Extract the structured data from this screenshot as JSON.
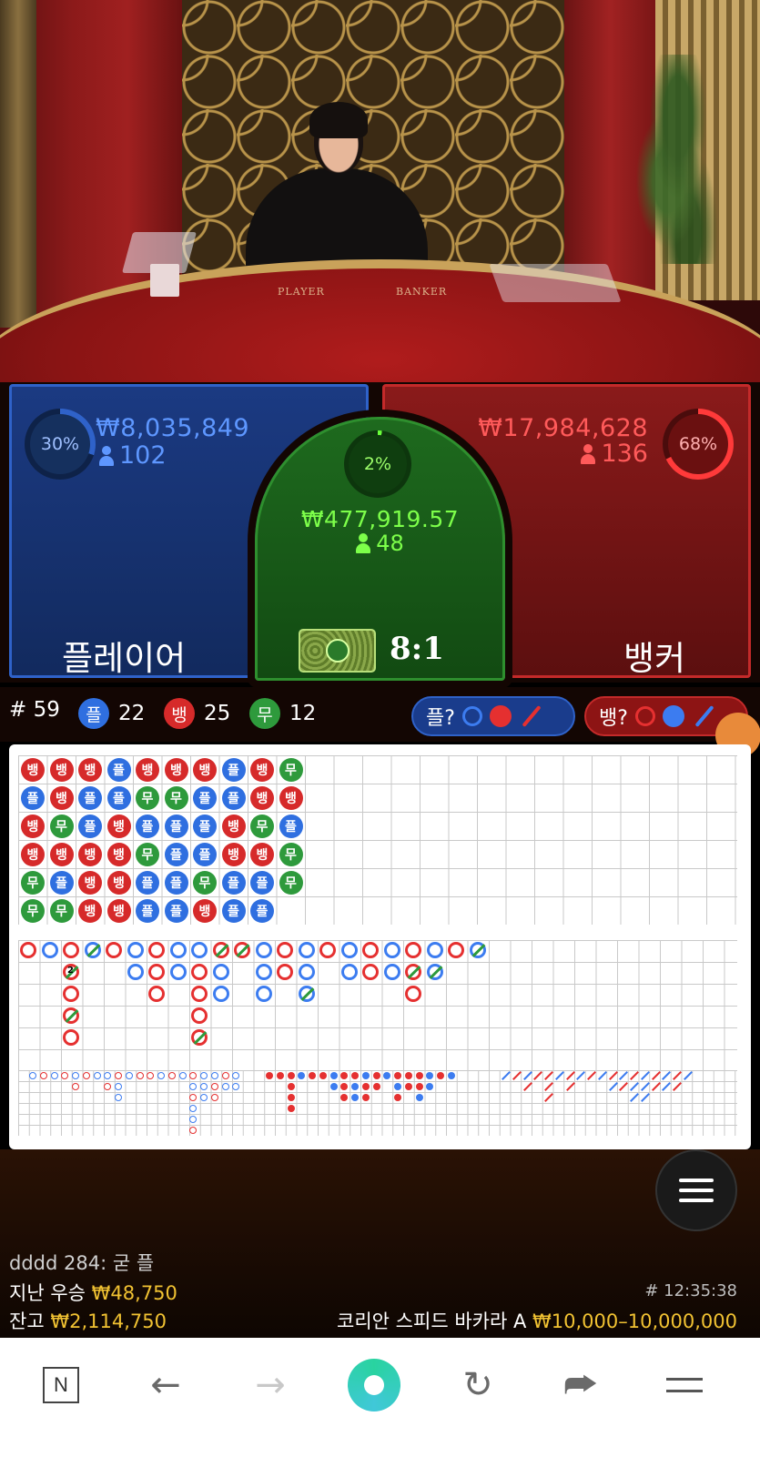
{
  "video": {
    "table_labels": [
      "PLAYER",
      "BANKER"
    ]
  },
  "player": {
    "percent": "30%",
    "percent_value": 30,
    "amount": "₩8,035,849",
    "count": "102",
    "label": "플레이어",
    "color": "#2f62c9"
  },
  "tie": {
    "percent": "2%",
    "percent_value": 2,
    "amount": "₩477,919.57",
    "count": "48",
    "payout": "8:1",
    "color": "#2e8f2e"
  },
  "banker": {
    "percent": "68%",
    "percent_value": 68,
    "amount": "₩17,984,628",
    "count": "136",
    "label": "뱅커",
    "color": "#c42a2a"
  },
  "stats": {
    "round": "# 59",
    "player_badge": "플",
    "player_count": "22",
    "banker_badge": "뱅",
    "banker_count": "25",
    "tie_badge": "무",
    "tie_count": "12"
  },
  "predict": {
    "player_label": "플?",
    "banker_label": "뱅?"
  },
  "bead_road": {
    "columns": [
      [
        "뱅",
        "플",
        "뱅",
        "뱅",
        "무",
        "무"
      ],
      [
        "뱅",
        "뱅",
        "무",
        "뱅",
        "플",
        "무"
      ],
      [
        "뱅",
        "플",
        "플",
        "뱅",
        "뱅",
        "뱅"
      ],
      [
        "플",
        "플",
        "뱅",
        "뱅",
        "뱅",
        "뱅"
      ],
      [
        "뱅",
        "무",
        "플",
        "무",
        "플",
        "플"
      ],
      [
        "뱅",
        "무",
        "플",
        "플",
        "플",
        "플"
      ],
      [
        "뱅",
        "플",
        "플",
        "플",
        "무",
        "뱅"
      ],
      [
        "플",
        "플",
        "뱅",
        "뱅",
        "플",
        "플"
      ],
      [
        "뱅",
        "뱅",
        "무",
        "뱅",
        "플",
        "플"
      ],
      [
        "무",
        "뱅",
        "플",
        "무",
        "무",
        ""
      ]
    ]
  },
  "big_road_tie_mark": "2",
  "chat": {
    "line": "dddd 284: 굳 플"
  },
  "last_win": {
    "label": "지난 우승",
    "amount": "₩48,750"
  },
  "balance": {
    "label": "잔고",
    "amount": "₩2,114,750"
  },
  "game": {
    "id_time": "# 12:35:38",
    "name": "코리안 스피드 바카라 A",
    "limits": "₩10,000–10,000,000"
  },
  "browser": {
    "n_label": "N",
    "back_icon": "←",
    "forward_icon": "→",
    "reload_icon": "↻",
    "share_icon": "⮫"
  }
}
